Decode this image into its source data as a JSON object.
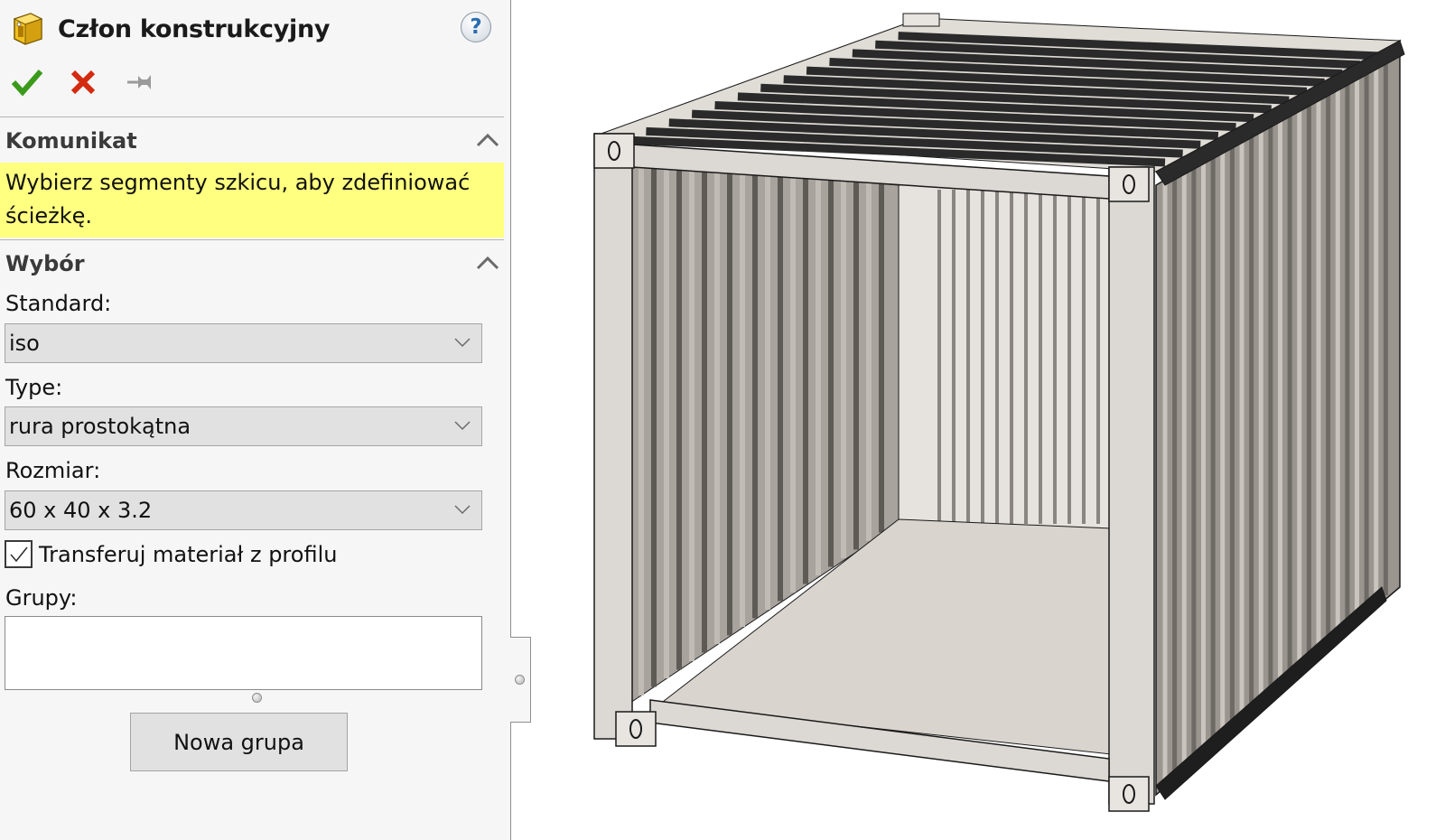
{
  "property_manager": {
    "title": "Człon konstrukcyjny",
    "title_icon": "structural-member-icon",
    "help_icon": "help-icon",
    "help_label": "?",
    "actions": [
      {
        "name": "ok",
        "icon": "checkmark-icon",
        "color": "#3a9a1a"
      },
      {
        "name": "cancel",
        "icon": "close-icon",
        "color": "#d42a10"
      },
      {
        "name": "pin",
        "icon": "pushpin-icon",
        "color": "#9a9a9a"
      }
    ]
  },
  "message_section": {
    "heading": "Komunikat",
    "text": "Wybierz segmenty szkicu, aby zdefiniować ścieżkę.",
    "background": "#ffff80"
  },
  "selection_section": {
    "heading": "Wybór",
    "standard": {
      "label": "Standard:",
      "value": "iso"
    },
    "type": {
      "label": "Type:",
      "value": "rura prostokątna"
    },
    "size": {
      "label": "Rozmiar:",
      "value": "60 x 40 x 3.2"
    },
    "transfer_material": {
      "label": "Transferuj materiał z profilu",
      "checked": true
    },
    "groups": {
      "label": "Grupy:",
      "items": []
    },
    "new_group_button": "Nowa grupa"
  },
  "viewport": {
    "model": "shipping-container-frame",
    "colors": {
      "frame": "#dcd8d3",
      "floor": "#d9d4ce",
      "roof_slats": "#2a2a2a",
      "wall_corrugation": "#8a8580",
      "edge": "#1a1a1a"
    }
  }
}
